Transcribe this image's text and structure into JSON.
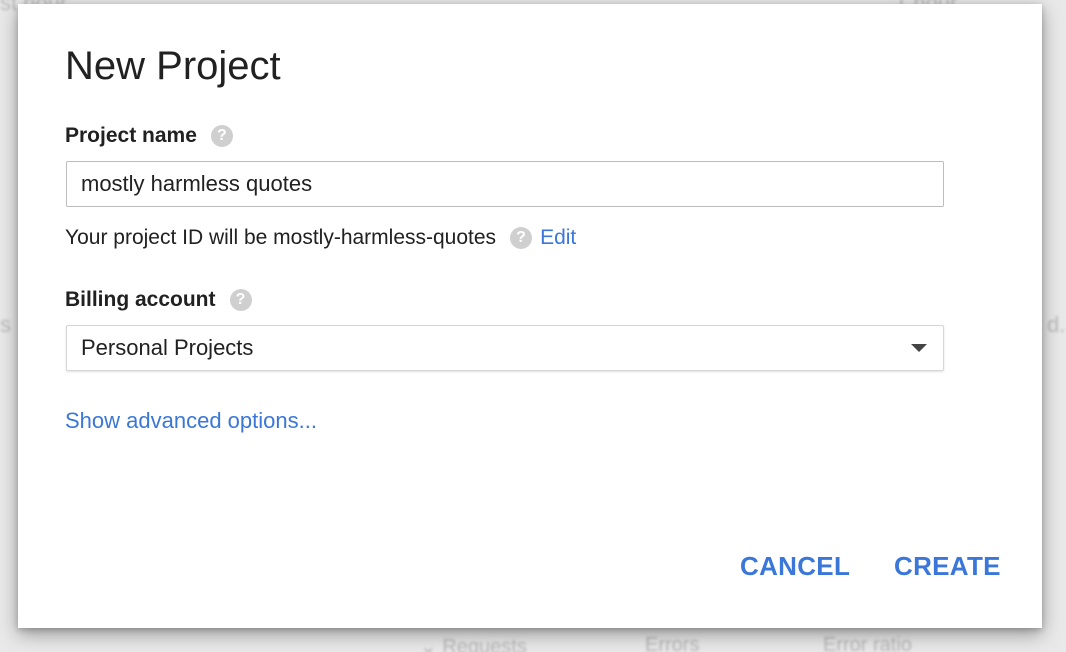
{
  "dialog": {
    "title": "New Project",
    "project_name_label": "Project name",
    "project_name_value": "mostly harmless quotes",
    "project_id_text": "Your project ID will be mostly-harmless-quotes",
    "edit_link": "Edit",
    "billing_label": "Billing account",
    "billing_value": "Personal Projects",
    "advanced_link": "Show advanced options...",
    "cancel_label": "CANCEL",
    "create_label": "CREATE",
    "help_glyph": "?"
  },
  "colors": {
    "accent": "#3a77d8",
    "help_icon": "#cfcfcf"
  }
}
